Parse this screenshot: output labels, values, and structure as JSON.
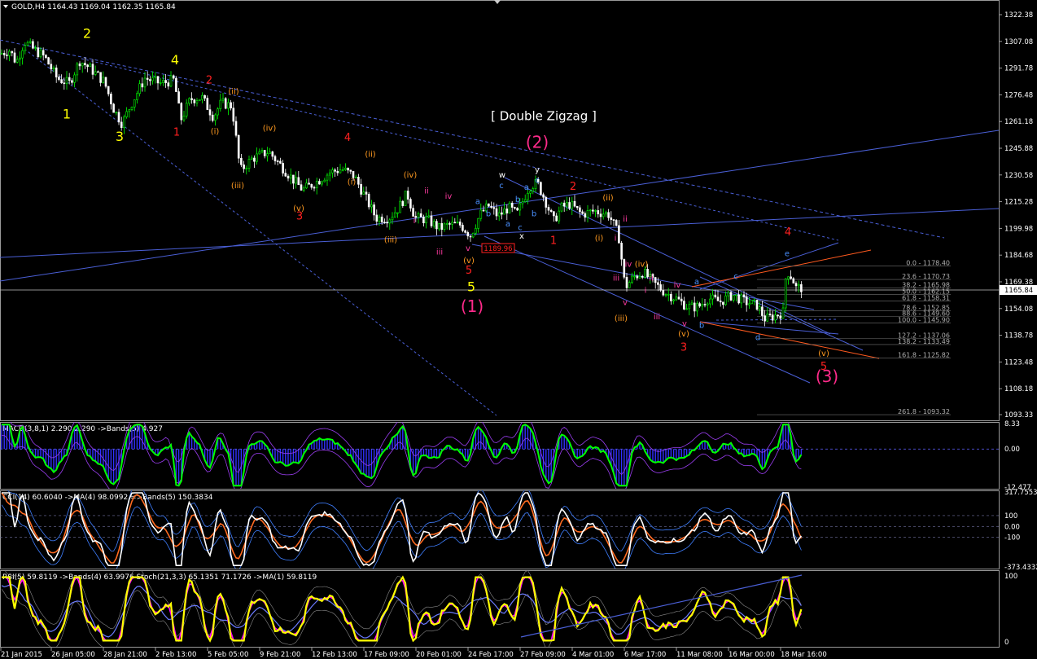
{
  "header": {
    "main": "GOLD,H4  1164.43 1169.04 1162.35 1165.84",
    "macd": "MACD(3,8,1) 2.290 2.290  ->Bands(5) 4.927",
    "cci": "CCI(14) 60.6040  ->MA(4) 98.0992  =>Bands(5) 150.3834",
    "rsi": "RSI(5) 59.8119  ->Bands(4) 63.9976  Stoch(21,3,3) 65.1351 71.1726  ->MA(1) 59.8119"
  },
  "colors": {
    "background": "#000000",
    "up_candle": "#00ff00",
    "down_candle": "#ffffff",
    "trend_lines": "#4a5fd6",
    "orange_line": "#ff5a1f",
    "macd_line": "#00ff00",
    "macd_hist": "#3030ff",
    "bands": "#9a3df0",
    "cci_line": "#ffffff",
    "cci_ma": "#ff6a20",
    "rsi_line": "#ffff00",
    "rsi_bands": "#ff00ff",
    "stoch": "#6b7bff",
    "wave_yellow": "#ffff00",
    "wave_red": "#ff2020",
    "wave_orange": "#ff9a20",
    "wave_magenta": "#ff2a8a",
    "wave_blue": "#4a90ff",
    "fib": "#b0b0b0"
  },
  "chart_data": [
    {
      "type": "candlestick",
      "symbol": "GOLD",
      "timeframe": "H4",
      "ylim": [
        1093.33,
        1322.38
      ],
      "y_ticks": [
        "1322.38",
        "1307.08",
        "1291.78",
        "1276.48",
        "1261.18",
        "1245.88",
        "1230.58",
        "1215.28",
        "1199.98",
        "1184.68",
        "1169.38",
        "1154.08",
        "1138.78",
        "1123.48",
        "1108.18",
        "1093.33"
      ],
      "x_labels": [
        "21 Jan 2015",
        "26 Jan 05:00",
        "28 Jan 21:00",
        "2 Feb 13:00",
        "5 Feb 05:00",
        "9 Feb 21:00",
        "12 Feb 13:00",
        "17 Feb 09:00",
        "20 Feb 01:00",
        "24 Feb 17:00",
        "27 Feb 09:00",
        "4 Mar 01:00",
        "6 Mar 17:00",
        "11 Mar 08:00",
        "16 Mar 00:00",
        "18 Mar 16:00"
      ],
      "last_price": "1165.84",
      "price_path": [
        [
          0,
          1300
        ],
        [
          12,
          1302
        ],
        [
          20,
          1295
        ],
        [
          30,
          1307
        ],
        [
          40,
          1303
        ],
        [
          55,
          1298
        ],
        [
          70,
          1286
        ],
        [
          85,
          1283
        ],
        [
          98,
          1296
        ],
        [
          110,
          1292
        ],
        [
          128,
          1284
        ],
        [
          140,
          1268
        ],
        [
          150,
          1260
        ],
        [
          162,
          1272
        ],
        [
          178,
          1286
        ],
        [
          198,
          1283
        ],
        [
          214,
          1285
        ],
        [
          222,
          1262
        ],
        [
          234,
          1274
        ],
        [
          248,
          1275
        ],
        [
          262,
          1264
        ],
        [
          272,
          1272
        ],
        [
          285,
          1270
        ],
        [
          295,
          1233
        ],
        [
          310,
          1240
        ],
        [
          330,
          1244
        ],
        [
          345,
          1236
        ],
        [
          360,
          1228
        ],
        [
          372,
          1222
        ],
        [
          390,
          1227
        ],
        [
          405,
          1232
        ],
        [
          420,
          1234
        ],
        [
          435,
          1230
        ],
        [
          452,
          1215
        ],
        [
          462,
          1206
        ],
        [
          478,
          1206
        ],
        [
          490,
          1212
        ],
        [
          500,
          1220
        ],
        [
          510,
          1206
        ],
        [
          525,
          1205
        ],
        [
          540,
          1200
        ],
        [
          552,
          1202
        ],
        [
          566,
          1202
        ],
        [
          578,
          1196
        ],
        [
          590,
          1208
        ],
        [
          600,
          1213
        ],
        [
          612,
          1207
        ],
        [
          625,
          1212
        ],
        [
          635,
          1208
        ],
        [
          650,
          1224
        ],
        [
          660,
          1226
        ],
        [
          670,
          1216
        ],
        [
          680,
          1204
        ],
        [
          690,
          1212
        ],
        [
          700,
          1214
        ],
        [
          715,
          1208
        ],
        [
          730,
          1210
        ],
        [
          748,
          1208
        ],
        [
          760,
          1196
        ],
        [
          768,
          1166
        ],
        [
          778,
          1172
        ],
        [
          790,
          1175
        ],
        [
          805,
          1168
        ],
        [
          818,
          1163
        ],
        [
          830,
          1160
        ],
        [
          845,
          1155
        ],
        [
          858,
          1155
        ],
        [
          870,
          1160
        ],
        [
          885,
          1158
        ],
        [
          900,
          1162
        ],
        [
          915,
          1158
        ],
        [
          930,
          1156
        ],
        [
          940,
          1148
        ],
        [
          952,
          1150
        ],
        [
          962,
          1152
        ],
        [
          966,
          1176
        ],
        [
          973,
          1172
        ],
        [
          978,
          1166
        ],
        [
          985,
          1166
        ]
      ],
      "price_extremes": {
        "low_marker": "1189.96"
      },
      "wave_labels": [
        {
          "text": "1",
          "x": 82,
          "y": 1263,
          "color": "yellow"
        },
        {
          "text": "2",
          "x": 107,
          "y": 1309,
          "color": "yellow"
        },
        {
          "text": "3",
          "x": 147,
          "y": 1250,
          "color": "yellow"
        },
        {
          "text": "4",
          "x": 215,
          "y": 1294,
          "color": "yellow"
        },
        {
          "text": "5",
          "x": 579,
          "y": 1164,
          "color": "yellow"
        },
        {
          "text": "(1)",
          "x": 580,
          "y": 1152,
          "color": "magenta"
        },
        {
          "text": "(2)",
          "x": 660,
          "y": 1246,
          "color": "magenta"
        },
        {
          "text": "(3)",
          "x": 1016,
          "y": 1112,
          "color": "magenta"
        },
        {
          "text": "[ Double Zigzag ]",
          "x": 668,
          "y": 1262,
          "color": "white"
        },
        {
          "text": "1",
          "x": 217,
          "y": 1253,
          "color": "red"
        },
        {
          "text": "2",
          "x": 257,
          "y": 1283,
          "color": "red"
        },
        {
          "text": "3",
          "x": 368,
          "y": 1205,
          "color": "red"
        },
        {
          "text": "4",
          "x": 427,
          "y": 1250,
          "color": "red"
        },
        {
          "text": "5",
          "x": 576,
          "y": 1174,
          "color": "red"
        },
        {
          "text": "1",
          "x": 680,
          "y": 1191,
          "color": "red"
        },
        {
          "text": "2",
          "x": 704,
          "y": 1222,
          "color": "red"
        },
        {
          "text": "3",
          "x": 840,
          "y": 1130,
          "color": "red"
        },
        {
          "text": "4",
          "x": 968,
          "y": 1196,
          "color": "red"
        },
        {
          "text": "5",
          "x": 1012,
          "y": 1119,
          "color": "red"
        },
        {
          "text": "(ii)",
          "x": 287,
          "y": 1277,
          "color": "orange"
        },
        {
          "text": "(i)",
          "x": 264,
          "y": 1254,
          "color": "orange"
        },
        {
          "text": "(iii)",
          "x": 292,
          "y": 1223,
          "color": "orange"
        },
        {
          "text": "(iv)",
          "x": 331,
          "y": 1256,
          "color": "orange"
        },
        {
          "text": "(v)",
          "x": 367,
          "y": 1210,
          "color": "orange"
        },
        {
          "text": "(ii)",
          "x": 455,
          "y": 1241,
          "color": "orange"
        },
        {
          "text": "(i)",
          "x": 432,
          "y": 1225,
          "color": "orange"
        },
        {
          "text": "(iii)",
          "x": 480,
          "y": 1192,
          "color": "orange"
        },
        {
          "text": "(iv)",
          "x": 504,
          "y": 1229,
          "color": "orange"
        },
        {
          "text": "(v)",
          "x": 576,
          "y": 1180,
          "color": "orange"
        },
        {
          "text": "(ii)",
          "x": 747,
          "y": 1216,
          "color": "orange"
        },
        {
          "text": "(i)",
          "x": 736,
          "y": 1193,
          "color": "orange"
        },
        {
          "text": "(iv)",
          "x": 788,
          "y": 1178,
          "color": "orange"
        },
        {
          "text": "(iii)",
          "x": 763,
          "y": 1147,
          "color": "orange"
        },
        {
          "text": "(v)",
          "x": 840,
          "y": 1138,
          "color": "orange"
        },
        {
          "text": "(v)",
          "x": 1012,
          "y": 1127,
          "color": "orange"
        },
        {
          "text": "ii",
          "x": 524,
          "y": 1220,
          "color": "pink"
        },
        {
          "text": "i",
          "x": 509,
          "y": 1203,
          "color": "pink"
        },
        {
          "text": "iv",
          "x": 551,
          "y": 1217,
          "color": "pink"
        },
        {
          "text": "iii",
          "x": 540,
          "y": 1185,
          "color": "pink"
        },
        {
          "text": "v",
          "x": 575,
          "y": 1187,
          "color": "pink"
        },
        {
          "text": "ii",
          "x": 768,
          "y": 1204,
          "color": "pink"
        },
        {
          "text": "i",
          "x": 756,
          "y": 1193,
          "color": "pink"
        },
        {
          "text": "iii",
          "x": 757,
          "y": 1170,
          "color": "pink"
        },
        {
          "text": "iv",
          "x": 772,
          "y": 1178,
          "color": "pink"
        },
        {
          "text": "ii",
          "x": 800,
          "y": 1170,
          "color": "pink"
        },
        {
          "text": "i",
          "x": 793,
          "y": 1163,
          "color": "pink"
        },
        {
          "text": "v",
          "x": 768,
          "y": 1156,
          "color": "pink"
        },
        {
          "text": "iv",
          "x": 832,
          "y": 1166,
          "color": "pink"
        },
        {
          "text": "iii",
          "x": 807,
          "y": 1148,
          "color": "pink"
        },
        {
          "text": "v",
          "x": 841,
          "y": 1144,
          "color": "pink"
        },
        {
          "text": "w",
          "x": 617,
          "y": 1229,
          "color": "white"
        },
        {
          "text": "x",
          "x": 641,
          "y": 1194,
          "color": "white"
        },
        {
          "text": "y",
          "x": 660,
          "y": 1232,
          "color": "white"
        },
        {
          "text": "a",
          "x": 587,
          "y": 1214,
          "color": "blue"
        },
        {
          "text": "b",
          "x": 600,
          "y": 1207,
          "color": "blue"
        },
        {
          "text": "c",
          "x": 616,
          "y": 1223,
          "color": "blue"
        },
        {
          "text": "a",
          "x": 624,
          "y": 1201,
          "color": "blue"
        },
        {
          "text": "b",
          "x": 636,
          "y": 1215,
          "color": "blue"
        },
        {
          "text": "c",
          "x": 639,
          "y": 1199,
          "color": "blue"
        },
        {
          "text": "a",
          "x": 647,
          "y": 1222,
          "color": "blue"
        },
        {
          "text": "b",
          "x": 656,
          "y": 1207,
          "color": "blue"
        },
        {
          "text": "c",
          "x": 660,
          "y": 1226,
          "color": "blue"
        },
        {
          "text": "a",
          "x": 856,
          "y": 1168,
          "color": "blue"
        },
        {
          "text": "b",
          "x": 862,
          "y": 1143,
          "color": "blue"
        },
        {
          "text": "c",
          "x": 904,
          "y": 1171,
          "color": "blue"
        },
        {
          "text": "d",
          "x": 931,
          "y": 1136,
          "color": "blue"
        },
        {
          "text": "e",
          "x": 967,
          "y": 1184,
          "color": "blue"
        }
      ],
      "fib_levels": [
        {
          "label": "0.0 - 1178.40",
          "price": 1178.4
        },
        {
          "label": "23.6 - 1170.73",
          "price": 1170.73
        },
        {
          "label": "38.2 - 1165.98",
          "price": 1165.98
        },
        {
          "label": "50.0 - 1162.15",
          "price": 1162.15
        },
        {
          "label": "61.8 - 1158.31",
          "price": 1158.31
        },
        {
          "label": "78.6 - 1152.85",
          "price": 1152.85
        },
        {
          "label": "88.6 - 1149.60",
          "price": 1149.6
        },
        {
          "label": "100.0 - 1145.90",
          "price": 1145.9
        },
        {
          "label": "127.2 - 1137.06",
          "price": 1137.06
        },
        {
          "label": "138.2 - 1133.49",
          "price": 1133.49
        },
        {
          "label": "161.8 - 1125.82",
          "price": 1125.82
        },
        {
          "label": "261.8 - 1093.32",
          "price": 1093.32
        }
      ]
    },
    {
      "type": "line",
      "name": "MACD",
      "ylim": [
        -12.477,
        8.33
      ],
      "y_ticks": [
        "8.33",
        "0.00",
        "-12.477"
      ]
    },
    {
      "type": "line",
      "name": "CCI",
      "ylim": [
        -373.4332,
        317.7553
      ],
      "y_ticks": [
        "317.7553",
        "100",
        "0.00",
        "-100",
        "-373.4332"
      ]
    },
    {
      "type": "line",
      "name": "RSI",
      "ylim": [
        0,
        100
      ],
      "y_ticks": [
        "100",
        "0"
      ]
    }
  ]
}
